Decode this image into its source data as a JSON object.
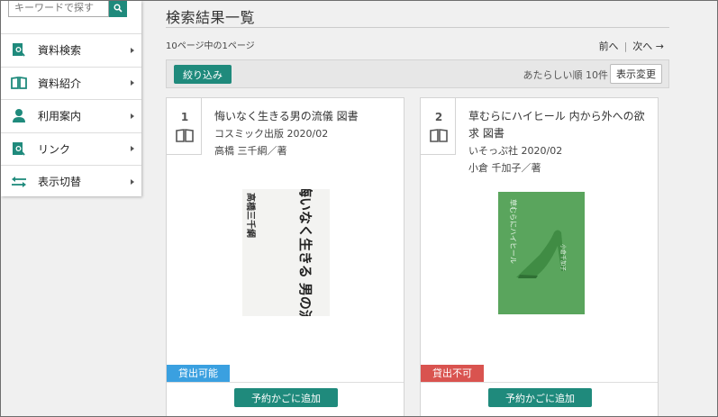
{
  "search": {
    "placeholder": "キーワードで探す"
  },
  "sidebar": {
    "items": [
      {
        "label": "資料検索",
        "icon": "document-search-icon"
      },
      {
        "label": "資料紹介",
        "icon": "open-book-icon"
      },
      {
        "label": "利用案内",
        "icon": "user-icon"
      },
      {
        "label": "リンク",
        "icon": "document-search-icon"
      },
      {
        "label": "表示切替",
        "icon": "swap-arrows-icon"
      }
    ]
  },
  "main": {
    "title": "検索結果一覧",
    "pager_info": "10ページ中の1ページ",
    "prev_label": "前へ",
    "next_label": "次へ →",
    "filter_label": "絞り込み",
    "sort_label": "あたらしい順 10件",
    "display_label": "表示変更"
  },
  "results": [
    {
      "number": "1",
      "title": "悔いなく生きる男の流儀 図書",
      "publisher": "コスミック出版 2020/02",
      "author": "高橋 三千綱／著",
      "cover_title": "悔いなく生きる 男の流儀",
      "cover_author": "高橋三千綱",
      "status": "貸出可能",
      "status_color": "#3aa0e0",
      "reserve_label": "予約かごに追加"
    },
    {
      "number": "2",
      "title": "草むらにハイヒール 内から外への欲求 図書",
      "publisher": "いそっぷ社 2020/02",
      "author": "小倉 千加子／著",
      "cover_title": "草むらにハイヒール",
      "cover_author": "小倉千加子",
      "status": "貸出不可",
      "status_color": "#d9534f",
      "reserve_label": "予約かごに追加"
    }
  ],
  "colors": {
    "accent": "#1f8a7c",
    "available": "#3aa0e0",
    "unavailable": "#d9534f"
  }
}
